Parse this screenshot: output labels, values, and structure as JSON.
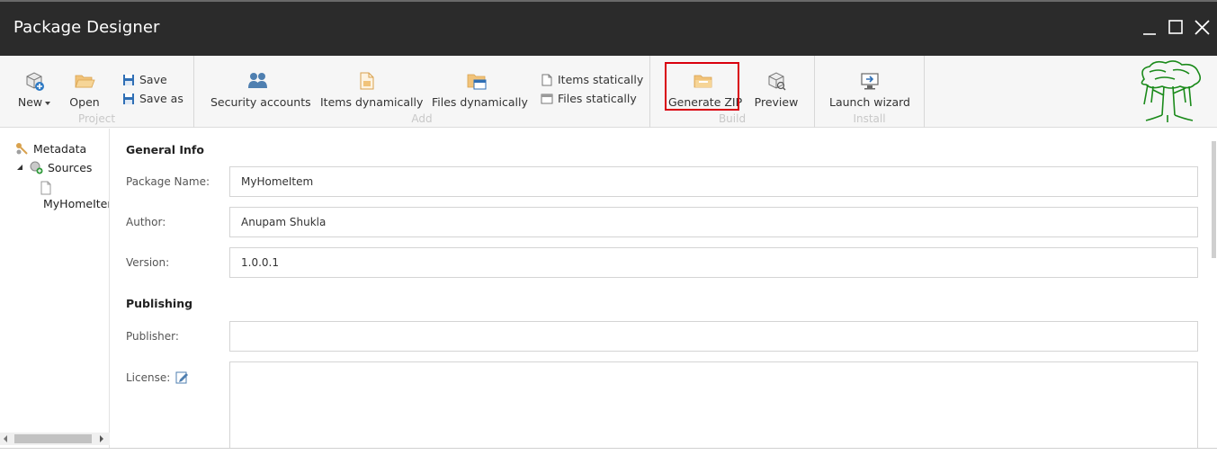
{
  "window": {
    "title": "Package Designer"
  },
  "ribbon": {
    "groups": {
      "project": "Project",
      "add": "Add",
      "build": "Build",
      "install": "Install"
    },
    "buttons": {
      "new": "New",
      "open": "Open",
      "save": "Save",
      "save_as": "Save as",
      "security_accounts": "Security accounts",
      "items_dynamically": "Items dynamically",
      "files_dynamically": "Files dynamically",
      "items_statically": "Items statically",
      "files_statically": "Files statically",
      "generate_zip": "Generate ZIP",
      "preview": "Preview",
      "launch_wizard": "Launch wizard"
    },
    "highlight_color": "#d9000d"
  },
  "tree": {
    "root": "Metadata",
    "sources": "Sources",
    "item": "MyHomeItem"
  },
  "form": {
    "general_info": "General Info",
    "package_name_label": "Package Name:",
    "package_name_value": "MyHomeItem",
    "author_label": "Author:",
    "author_value": "Anupam Shukla",
    "version_label": "Version:",
    "version_value": "1.0.0.1",
    "publishing": "Publishing",
    "publisher_label": "Publisher:",
    "publisher_value": "",
    "license_label": "License:"
  },
  "colors": {
    "titlebar": "#2b2b2b",
    "ribbon": "#f6f6f6",
    "logo_green": "#1a8a1a"
  }
}
